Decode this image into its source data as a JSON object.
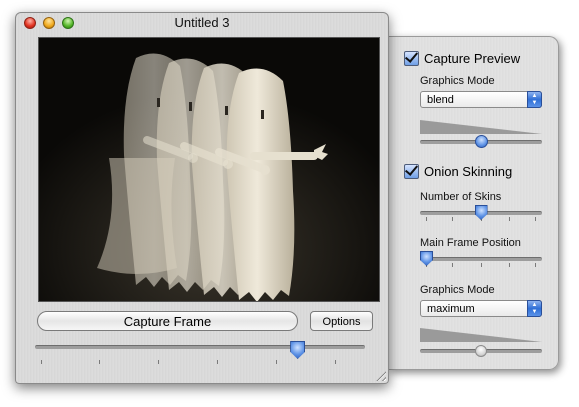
{
  "window": {
    "title": "Untitled 3"
  },
  "capture": {
    "capture_frame_label": "Capture Frame",
    "options_label": "Options",
    "frame_slider_position": 0.81
  },
  "drawer": {
    "capture_preview": {
      "label": "Capture Preview",
      "checked": true,
      "graphics_mode_label": "Graphics Mode",
      "graphics_mode_value": "blend",
      "opacity_position": 0.5
    },
    "onion_skinning": {
      "label": "Onion Skinning",
      "checked": true,
      "number_of_skins_label": "Number of Skins",
      "number_of_skins_position": 0.5,
      "main_frame_position_label": "Main Frame Position",
      "main_frame_position_value": 0.0,
      "graphics_mode_label": "Graphics Mode",
      "graphics_mode_value": "maximum",
      "opacity_position": 0.5
    }
  },
  "icons": {
    "close": "close-icon",
    "minimize": "minimize-icon",
    "zoom": "zoom-icon",
    "popup_arrows": "chevron-up-down-icon",
    "resize": "resize-grip-icon"
  },
  "colors": {
    "accent_blue": "#3a78dc",
    "close_red": "#e0301e",
    "minimize_yellow": "#f0a81a",
    "zoom_green": "#52b526"
  }
}
